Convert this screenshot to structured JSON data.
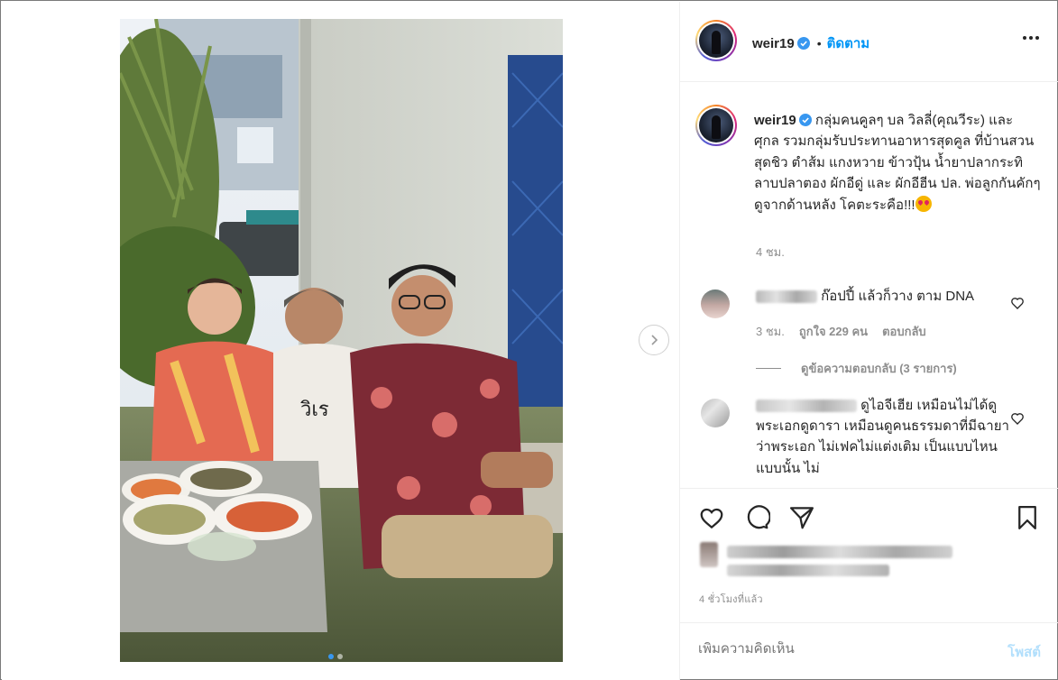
{
  "post": {
    "username": "weir19",
    "follow_label": "ติดตาม",
    "bullet": "•",
    "more_icon": "more-horizontal-icon",
    "verified_color": "#3897f0",
    "accent": "#0095f6"
  },
  "caption": {
    "username": "weir19",
    "text": "กลุ่มคนคูลๆ บล วิลลี่(คุณวีระ) และ ศุกล รวมกลุ่มรับประทานอาหารสุดคูล ที่บ้านสวนสุดชิว ตำส้ม แกงหวาย ข้าวปุ้น น้ำยาปลากระทิ ลาบปลาตอง ผักอีดู่ และ ผักอีฮีน ปล. พ่อลูกกันคักๆ ดูจากด้านหลัง โคตะระคือ!!!",
    "time": "4 ชม."
  },
  "comments": [
    {
      "text": "ก๊อปปี้ แล้วก็วาง ตาม DNA",
      "time": "3 ชม.",
      "likes": "ถูกใจ 229 คน",
      "reply_label": "ตอบกลับ"
    },
    {
      "text": "ดูไอจีเฮีย เหมือนไม่ได้ดูพระเอกดูดารา เหมือนดูคนธรรมดาที่มีฉายาว่าพระเอก ไม่เฟคไม่แต่งเติม เป็นแบบไหนแบบนั้น ไม่"
    }
  ],
  "view_replies": "ดูข้อความตอบกลับ (3 รายการ)",
  "post_time": "4 ชั่วโมงที่แล้ว",
  "comment_input": {
    "placeholder": "เพิ่มความคิดเห็น",
    "post_label": "โพสต์"
  },
  "icons": [
    "heart-icon",
    "comment-icon",
    "share-icon",
    "bookmark-icon",
    "chevron-right-icon"
  ]
}
